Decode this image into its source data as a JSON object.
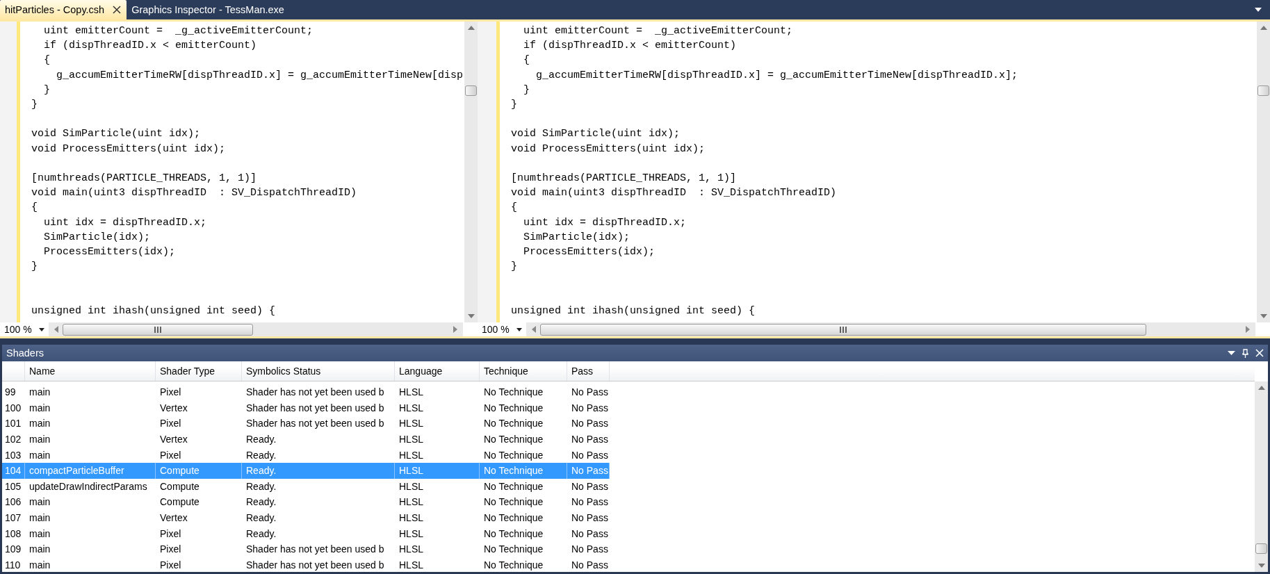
{
  "tabs": [
    {
      "label": "hitParticles - Copy.csh",
      "selected": true
    },
    {
      "label": "Graphics Inspector - TessMan.exe",
      "selected": false
    }
  ],
  "editor_panes": [
    {
      "code": "  uint emitterCount =  _g_activeEmitterCount;\n  if (dispThreadID.x < emitterCount)\n  {\n    g_accumEmitterTimeRW[dispThreadID.x] = g_accumEmitterTimeNew[disp\n  }\n}\n\nvoid SimParticle(uint idx);\nvoid ProcessEmitters(uint idx);\n\n[numthreads(PARTICLE_THREADS, 1, 1)]\nvoid main(uint3 dispThreadID  : SV_DispatchThreadID)\n{\n  uint idx = dispThreadID.x;\n  SimParticle(idx);\n  ProcessEmitters(idx);\n}\n\n\nunsigned int ihash(unsigned int seed) {",
      "zoom": "100 %"
    },
    {
      "code": "  uint emitterCount =  _g_activeEmitterCount;\n  if (dispThreadID.x < emitterCount)\n  {\n    g_accumEmitterTimeRW[dispThreadID.x] = g_accumEmitterTimeNew[dispThreadID.x];\n  }\n}\n\nvoid SimParticle(uint idx);\nvoid ProcessEmitters(uint idx);\n\n[numthreads(PARTICLE_THREADS, 1, 1)]\nvoid main(uint3 dispThreadID  : SV_DispatchThreadID)\n{\n  uint idx = dispThreadID.x;\n  SimParticle(idx);\n  ProcessEmitters(idx);\n}\n\n\nunsigned int ihash(unsigned int seed) {",
      "zoom": "100 %"
    }
  ],
  "shaders_panel": {
    "title": "Shaders",
    "table": {
      "columns": [
        "Name",
        "Shader Type",
        "Symbolics Status",
        "Language",
        "Technique",
        "Pass"
      ],
      "rows": [
        {
          "number": "99",
          "cells": [
            "main",
            "Pixel",
            "Shader has not yet been used b",
            "HLSL",
            "No Technique",
            "No Pass"
          ],
          "selected": false
        },
        {
          "number": "100",
          "cells": [
            "main",
            "Vertex",
            "Shader has not yet been used b",
            "HLSL",
            "No Technique",
            "No Pass"
          ],
          "selected": false
        },
        {
          "number": "101",
          "cells": [
            "main",
            "Pixel",
            "Shader has not yet been used b",
            "HLSL",
            "No Technique",
            "No Pass"
          ],
          "selected": false
        },
        {
          "number": "102",
          "cells": [
            "main",
            "Vertex",
            "Ready.",
            "HLSL",
            "No Technique",
            "No Pass"
          ],
          "selected": false
        },
        {
          "number": "103",
          "cells": [
            "main",
            "Pixel",
            "Ready.",
            "HLSL",
            "No Technique",
            "No Pass"
          ],
          "selected": false
        },
        {
          "number": "104",
          "cells": [
            "compactParticleBuffer",
            "Compute",
            "Ready.",
            "HLSL",
            "No Technique",
            "No Pass"
          ],
          "selected": true
        },
        {
          "number": "105",
          "cells": [
            "updateDrawIndirectParams",
            "Compute",
            "Ready.",
            "HLSL",
            "No Technique",
            "No Pass"
          ],
          "selected": false
        },
        {
          "number": "106",
          "cells": [
            "main",
            "Compute",
            "Ready.",
            "HLSL",
            "No Technique",
            "No Pass"
          ],
          "selected": false
        },
        {
          "number": "107",
          "cells": [
            "main",
            "Vertex",
            "Ready.",
            "HLSL",
            "No Technique",
            "No Pass"
          ],
          "selected": false
        },
        {
          "number": "108",
          "cells": [
            "main",
            "Pixel",
            "Ready.",
            "HLSL",
            "No Technique",
            "No Pass"
          ],
          "selected": false
        },
        {
          "number": "109",
          "cells": [
            "main",
            "Pixel",
            "Shader has not yet been used b",
            "HLSL",
            "No Technique",
            "No Pass"
          ],
          "selected": false
        },
        {
          "number": "110",
          "cells": [
            "main",
            "Pixel",
            "Shader has not yet been used b",
            "HLSL",
            "No Technique",
            "No Pass"
          ],
          "selected": false
        }
      ]
    }
  }
}
